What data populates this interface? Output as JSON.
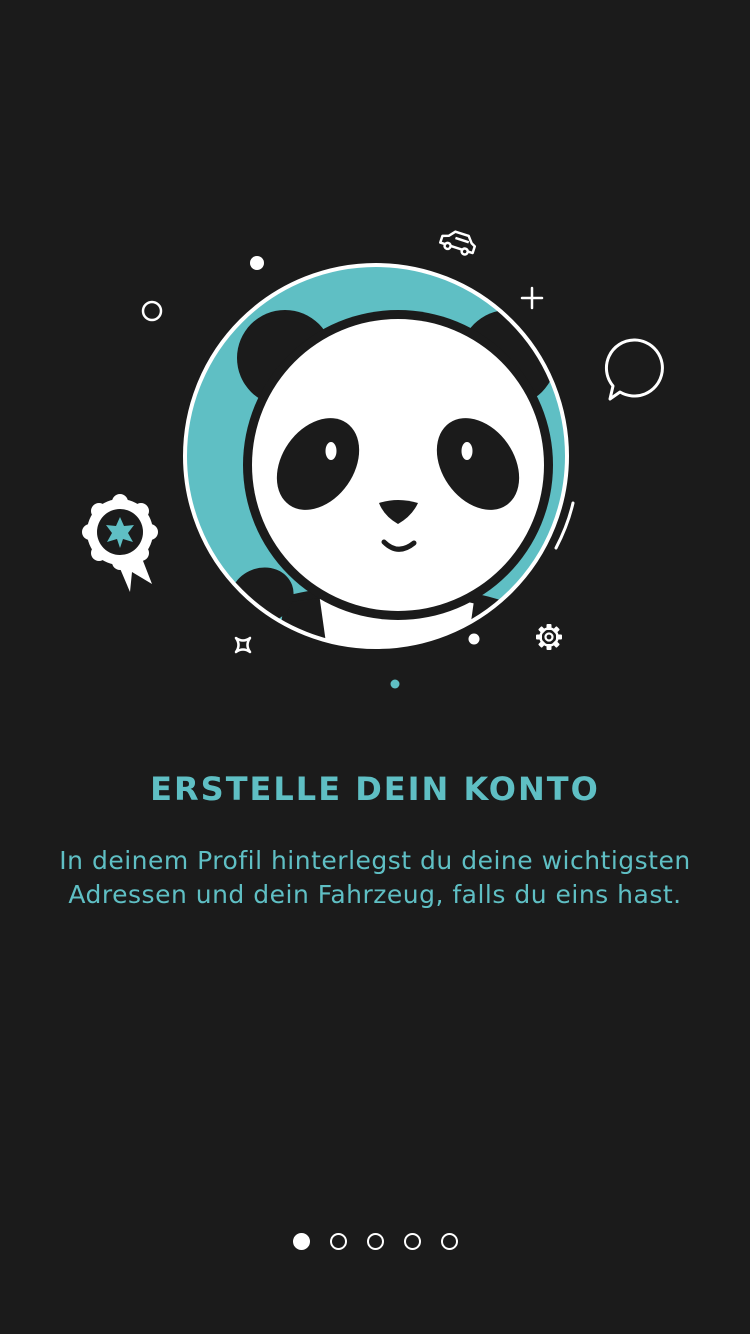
{
  "onboarding": {
    "title": "ERSTELLE DEIN KONTO",
    "description": "In deinem Profil hinterlegst du deine wichtigsten Adressen und dein Fahrzeug, falls du eins hast.",
    "pages_total": 5,
    "current_page": 1
  },
  "illustration": {
    "character": "panda",
    "icons": [
      "car-icon",
      "chat-bubble-icon",
      "award-ribbon-icon",
      "gear-icon",
      "sparkle-icon",
      "plus-icon"
    ]
  },
  "colors": {
    "background": "#1b1b1b",
    "accent": "#5fbfc4",
    "white": "#ffffff",
    "dark": "#1b1b1b"
  }
}
